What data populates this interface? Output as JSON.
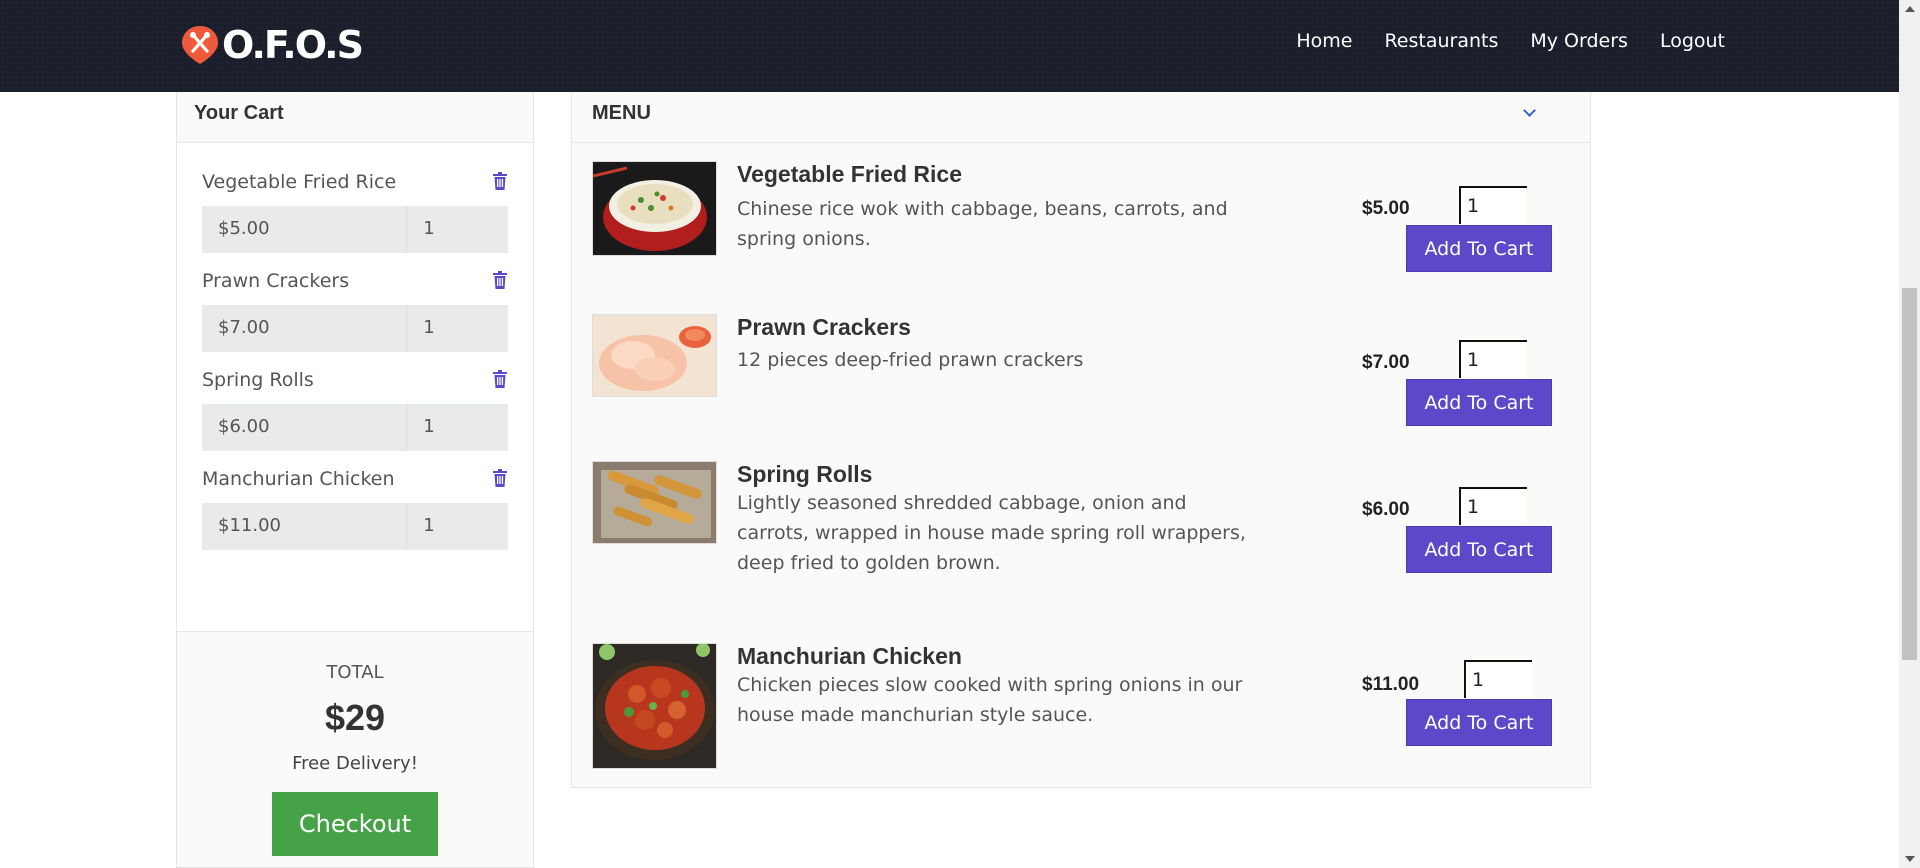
{
  "header": {
    "logo_text": "O.F.O.S",
    "nav": [
      "Home",
      "Restaurants",
      "My Orders",
      "Logout"
    ]
  },
  "cart": {
    "title": "Your Cart",
    "items": [
      {
        "name": "Vegetable Fried Rice",
        "price": "$5.00",
        "qty": "1"
      },
      {
        "name": "Prawn Crackers",
        "price": "$7.00",
        "qty": "1"
      },
      {
        "name": "Spring Rolls",
        "price": "$6.00",
        "qty": "1"
      },
      {
        "name": "Manchurian Chicken",
        "price": "$11.00",
        "qty": "1"
      }
    ],
    "total_label": "TOTAL",
    "total_value": "$29",
    "delivery_note": "Free Delivery!",
    "checkout_label": "Checkout"
  },
  "menu": {
    "title": "MENU",
    "items": [
      {
        "name": "Vegetable Fried Rice",
        "description": "Chinese rice wok with cabbage, beans, carrots, and spring onions.",
        "price": "$5.00",
        "qty": "1",
        "button": "Add To Cart"
      },
      {
        "name": "Prawn Crackers",
        "description": "12 pieces deep-fried prawn crackers",
        "price": "$7.00",
        "qty": "1",
        "button": "Add To Cart"
      },
      {
        "name": "Spring Rolls",
        "description": "Lightly seasoned shredded cabbage, onion and carrots, wrapped in house made spring roll wrappers, deep fried to golden brown.",
        "price": "$6.00",
        "qty": "1",
        "button": "Add To Cart"
      },
      {
        "name": "Manchurian Chicken",
        "description": "Chicken pieces slow cooked with spring onions in our house made manchurian style sauce.",
        "price": "$11.00",
        "qty": "1",
        "button": "Add To Cart"
      }
    ]
  },
  "colors": {
    "navbar": "#1b1f2c",
    "logo_accent": "#f05a3c",
    "add_to_cart": "#5b49c9",
    "checkout": "#45a247",
    "trash_icon": "#5b49c9"
  },
  "icons": [
    "logo-icon",
    "trash-icon",
    "chevron-down-icon"
  ]
}
